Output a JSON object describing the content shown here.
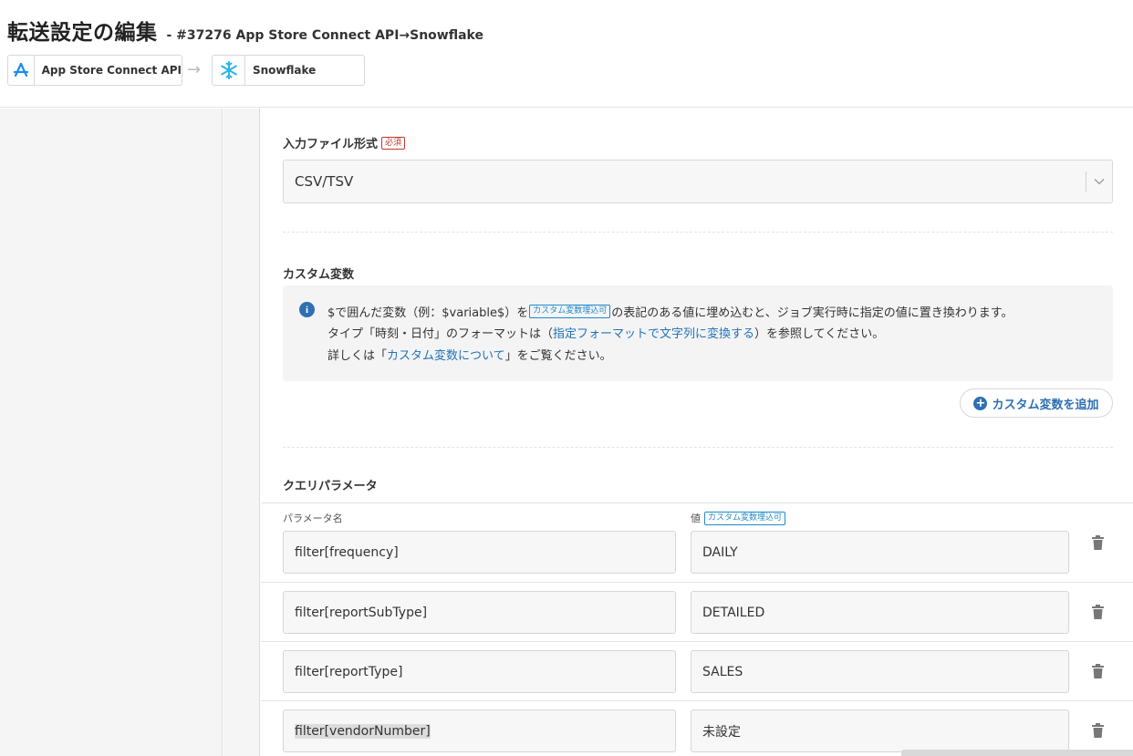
{
  "header": {
    "title": "転送設定の編集",
    "subtitle": "- #37276 App Store Connect API→Snowflake",
    "source_connector": {
      "label": "App Store Connect API",
      "icon": "app-store-icon"
    },
    "arrow": "→",
    "destination_connector": {
      "label": "Snowflake",
      "icon": "snowflake-icon"
    }
  },
  "input_format": {
    "label": "入力ファイル形式",
    "required_badge": "必須",
    "value": "CSV/TSV"
  },
  "custom_variables": {
    "label": "カスタム変数",
    "info": {
      "line1_prefix": "$で囲んだ変数（例：$variable$）を",
      "line1_badge": "カスタム変数埋込可",
      "line1_suffix": "の表記のある値に埋め込むと、ジョブ実行時に指定の値に置き換わります。",
      "line2_prefix": "タイプ「時刻・日付」のフォーマットは（",
      "line2_link": "指定フォーマットで文字列に変換する",
      "line2_suffix": "）を参照してください。",
      "line3_prefix": "詳しくは「",
      "line3_link": "カスタム変数について",
      "line3_suffix": "」をご覧ください。"
    },
    "add_button": "カスタム変数を追加"
  },
  "query_params": {
    "label": "クエリパラメータ",
    "name_header": "パラメータ名",
    "value_header": "値",
    "value_badge": "カスタム変数埋込可",
    "rows": [
      {
        "name": "filter[frequency]",
        "value": "DAILY"
      },
      {
        "name": "filter[reportSubType]",
        "value": "DETAILED"
      },
      {
        "name": "filter[reportType]",
        "value": "SALES"
      },
      {
        "name": "filter[vendorNumber]",
        "value": "未設定"
      }
    ]
  },
  "colors": {
    "accent": "#2f6fb2",
    "link": "#1f73b7",
    "required": "#c0392b",
    "badge": "#1f8ac9"
  }
}
